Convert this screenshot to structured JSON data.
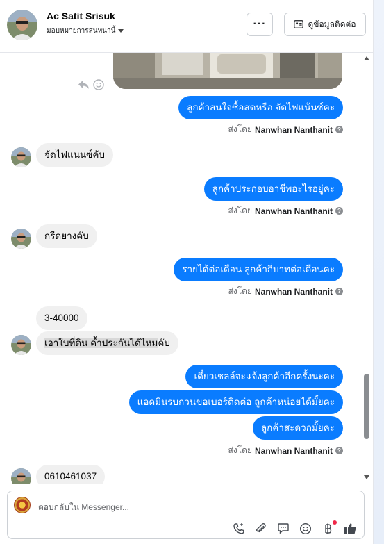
{
  "header": {
    "contact_name": "Ac Satit Srisuk",
    "assigned_to": "มอบหมายการสนทนานี้",
    "more_label": "···",
    "contact_info_label": "ดูข้อมูลติดต่อ"
  },
  "messages": [
    {
      "dir": "out",
      "text": "ลูกค้าสนใจซื้อสดหรือ จัดไฟแน้นซ์คะ"
    },
    {
      "dir": "in",
      "text": "จัดไฟแนนซ์คับ"
    },
    {
      "dir": "out",
      "text": "ลูกค้าประกอบอาชีพอะไรอยู่คะ"
    },
    {
      "dir": "in",
      "text": "กรีดยางคับ"
    },
    {
      "dir": "out",
      "text": "รายได้ต่อเดือน ลูกค้ากี่บาทต่อเดือนคะ"
    },
    {
      "dir": "in",
      "text": "3-40000"
    },
    {
      "dir": "in",
      "text": "เอาใบที่ดิน  ค้ำประกันได้ไหมคับ",
      "highlight": "เอาใบที่ดิน  ค้ำประกันได้ไหม",
      "rest": "คับ"
    },
    {
      "dir": "out",
      "text": "เดี๋ยวเชลล์จะแจ้งลูกค้าอีกครั้งนะคะ"
    },
    {
      "dir": "out",
      "text": "แอดมินรบกวนขอเบอร์ติดต่อ ลูกค้าหน่อยได้มั้ยคะ"
    },
    {
      "dir": "out",
      "text": "ลูกค้าสะดวกมั้ยคะ"
    },
    {
      "dir": "in",
      "text": "0610461037"
    }
  ],
  "sent_by": {
    "prefix": "ส่งโดย",
    "name": "Nanwhan Nanthanit"
  },
  "composer": {
    "placeholder": "ตอบกลับใน Messenger..."
  },
  "icons": {
    "reply": "reply-icon",
    "react": "smiley-icon",
    "call": "phone-icon",
    "attach": "paperclip-icon",
    "saved_reply": "chat-bubble-icon",
    "emoji": "emoji-icon",
    "payment": "baht-icon",
    "like": "thumbs-up-icon"
  },
  "colors": {
    "outgoing_bubble": "#0a7cff",
    "incoming_bubble": "#f0f0f0",
    "notification_dot": "#f02849"
  }
}
